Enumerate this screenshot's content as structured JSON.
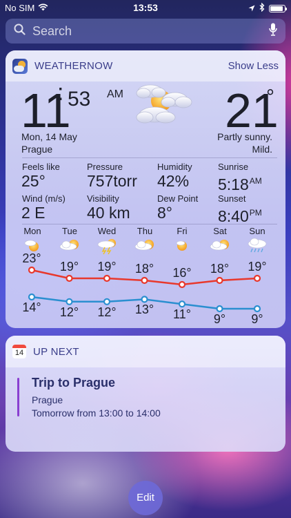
{
  "status_bar": {
    "carrier": "No SIM",
    "time": "13:53",
    "battery_level": 0.9
  },
  "search": {
    "placeholder": "Search"
  },
  "weather_widget": {
    "app_name": "WEATHERNOW",
    "toggle_label": "Show Less",
    "time": {
      "hour": "11",
      "separator": ":",
      "minute": "53",
      "ampm": "AM"
    },
    "date": "Mon, 14 May",
    "city": "Prague",
    "temperature": "21",
    "temperature_unit": "°",
    "condition": "Partly sunny.",
    "condition_detail": "Mild.",
    "stats": [
      {
        "label": "Feels like",
        "value": "25°"
      },
      {
        "label": "Pressure",
        "value": "757torr"
      },
      {
        "label": "Humidity",
        "value": "42%"
      },
      {
        "label": "Sunrise",
        "value": "5:18",
        "suffix": "AM"
      },
      {
        "label": "Wind (m/s)",
        "value": "2 E"
      },
      {
        "label": "Visibility",
        "value": "40 km"
      },
      {
        "label": "Dew Point",
        "value": "8°"
      },
      {
        "label": "Sunset",
        "value": "8:40",
        "suffix": "PM"
      }
    ],
    "forecast": [
      {
        "day": "Mon",
        "icon": "sun-cloud-icon",
        "high": "23°",
        "low": "14°"
      },
      {
        "day": "Tue",
        "icon": "cloud-sun-icon",
        "high": "19°",
        "low": "12°"
      },
      {
        "day": "Wed",
        "icon": "thunderstorm-sun-icon",
        "high": "19°",
        "low": "12°"
      },
      {
        "day": "Thu",
        "icon": "cloud-sun-icon",
        "high": "18°",
        "low": "13°"
      },
      {
        "day": "Fri",
        "icon": "sun-cloud-icon",
        "high": "16°",
        "low": "11°"
      },
      {
        "day": "Sat",
        "icon": "cloud-sun-icon",
        "high": "18°",
        "low": "9°"
      },
      {
        "day": "Sun",
        "icon": "rain-cloud-icon",
        "high": "19°",
        "low": "9°"
      }
    ],
    "chart_data": {
      "type": "line",
      "categories": [
        "Mon",
        "Tue",
        "Wed",
        "Thu",
        "Fri",
        "Sat",
        "Sun"
      ],
      "series": [
        {
          "values": [
            23,
            19,
            19,
            18,
            16,
            18,
            19
          ],
          "color": "#e8382c"
        },
        {
          "values": [
            14,
            12,
            12,
            13,
            11,
            9,
            9
          ],
          "color": "#2a8fd0"
        }
      ]
    }
  },
  "up_next_widget": {
    "calendar_day": "14",
    "title": "UP NEXT",
    "event": {
      "title": "Trip to Prague",
      "location": "Prague",
      "time": "Tomorrow from 13:00 to 14:00"
    }
  },
  "edit_button": {
    "label": "Edit"
  }
}
